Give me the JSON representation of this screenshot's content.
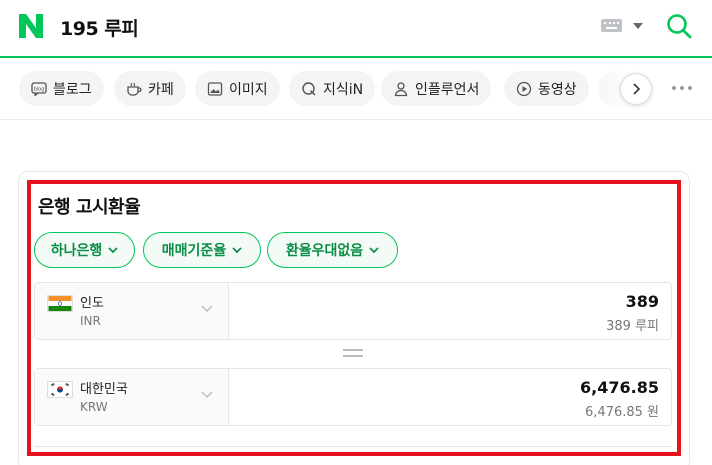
{
  "header": {
    "query": "195 루피"
  },
  "tabs": [
    {
      "label": "블로그",
      "icon": "blog-icon"
    },
    {
      "label": "카페",
      "icon": "cafe-icon"
    },
    {
      "label": "이미지",
      "icon": "image-icon"
    },
    {
      "label": "지식iN",
      "icon": "search-q-icon"
    },
    {
      "label": "인플루언서",
      "icon": "person-icon"
    },
    {
      "label": "동영상",
      "icon": "play-icon"
    }
  ],
  "card": {
    "title": "은행 고시환율",
    "filters": [
      "하나은행",
      "매매기준율",
      "환율우대없음"
    ]
  },
  "from": {
    "name": "인도",
    "code": "INR",
    "amount": "389",
    "amount_sub": "389 루피"
  },
  "to": {
    "name": "대한민국",
    "code": "KRW",
    "amount": "6,476.85",
    "amount_sub": "6,476.85 원"
  },
  "colors": {
    "brand_green": "#03c75a",
    "filter_text": "#0a8d46",
    "highlight_red": "#e3141e"
  }
}
